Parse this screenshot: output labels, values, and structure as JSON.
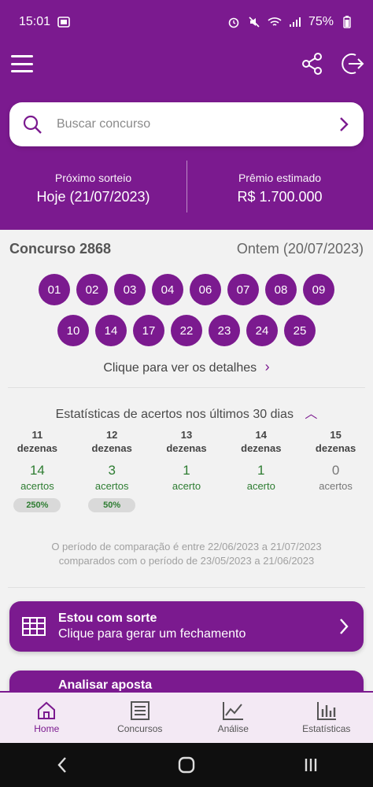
{
  "status_bar": {
    "time": "15:01",
    "battery": "75%"
  },
  "search": {
    "placeholder": "Buscar concurso"
  },
  "next_draw": {
    "label": "Próximo sorteio",
    "value": "Hoje (21/07/2023)"
  },
  "prize": {
    "label": "Prêmio estimado",
    "value": "R$ 1.700.000"
  },
  "contest": {
    "title": "Concurso 2868",
    "date": "Ontem (20/07/2023)",
    "numbers": [
      "01",
      "02",
      "03",
      "04",
      "06",
      "07",
      "08",
      "09",
      "10",
      "14",
      "17",
      "22",
      "23",
      "24",
      "25"
    ],
    "details_link": "Clique para ver os detalhes"
  },
  "stats": {
    "title": "Estatísticas de acertos nos últimos 30 dias",
    "columns": [
      {
        "head1": "11",
        "head2": "dezenas",
        "count": "14",
        "unit": "acertos",
        "badge": "250%"
      },
      {
        "head1": "12",
        "head2": "dezenas",
        "count": "3",
        "unit": "acertos",
        "badge": "50%"
      },
      {
        "head1": "13",
        "head2": "dezenas",
        "count": "1",
        "unit": "acerto",
        "badge": ""
      },
      {
        "head1": "14",
        "head2": "dezenas",
        "count": "1",
        "unit": "acerto",
        "badge": ""
      },
      {
        "head1": "15",
        "head2": "dezenas",
        "count": "0",
        "unit": "acertos",
        "badge": ""
      }
    ],
    "note_line1": "O período de comparação é entre 22/06/2023 a 21/07/2023",
    "note_line2": "comparados com o período de 23/05/2023 a 21/06/2023"
  },
  "cards": {
    "lucky_title": "Estou com sorte",
    "lucky_sub": "Clique para gerar um fechamento",
    "analyze_title": "Analisar aposta"
  },
  "bottom_nav": [
    {
      "label": "Home"
    },
    {
      "label": "Concursos"
    },
    {
      "label": "Análise"
    },
    {
      "label": "Estatísticas"
    }
  ],
  "colors": {
    "brand": "#7b1a8f",
    "success": "#2e7d32"
  }
}
